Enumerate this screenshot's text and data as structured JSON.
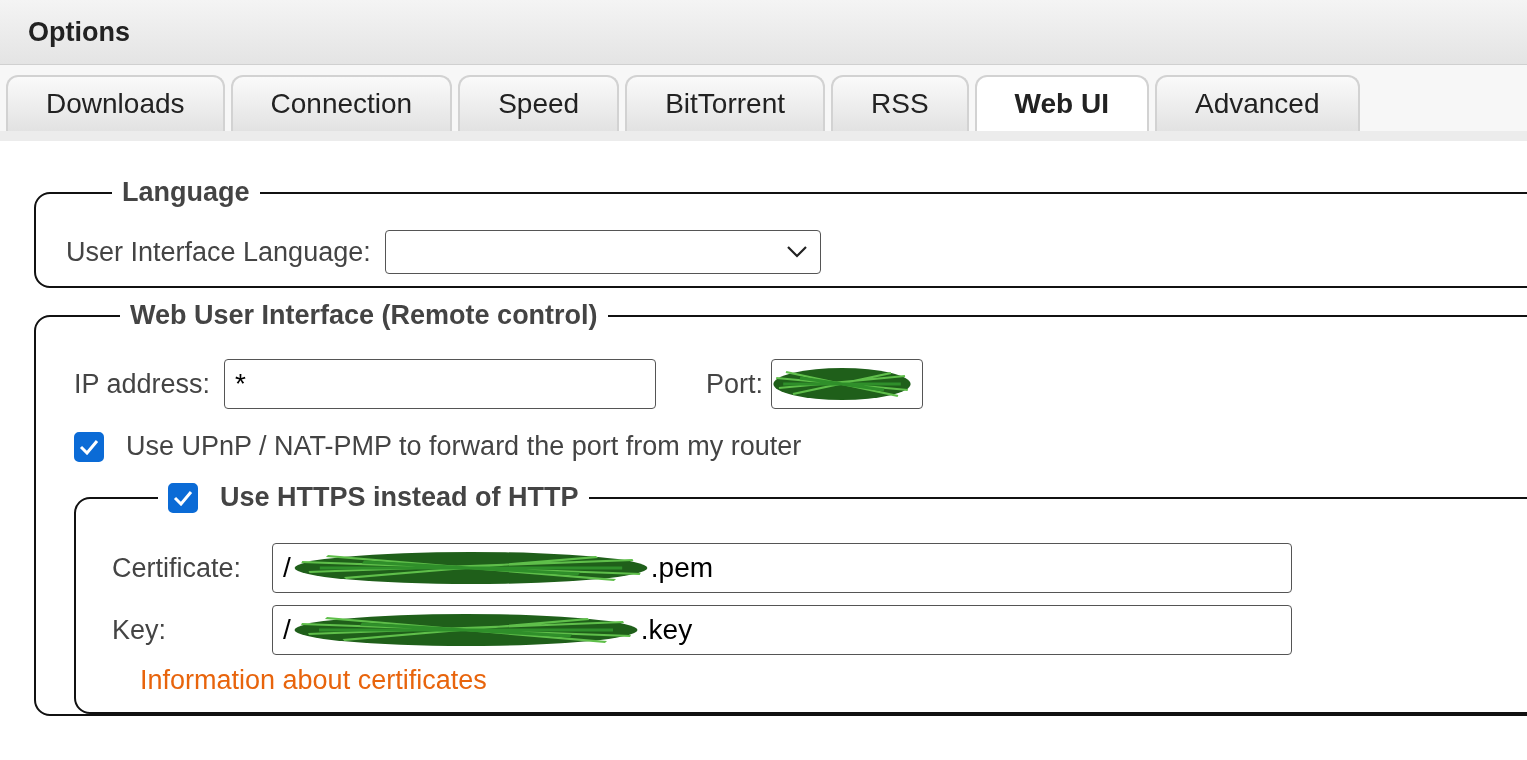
{
  "window": {
    "title": "Options"
  },
  "tabs": [
    {
      "label": "Downloads",
      "selected": false
    },
    {
      "label": "Connection",
      "selected": false
    },
    {
      "label": "Speed",
      "selected": false
    },
    {
      "label": "BitTorrent",
      "selected": false
    },
    {
      "label": "RSS",
      "selected": false
    },
    {
      "label": "Web UI",
      "selected": true
    },
    {
      "label": "Advanced",
      "selected": false
    }
  ],
  "language": {
    "legend": "Language",
    "label": "User Interface Language:"
  },
  "web_ui": {
    "legend": "Web User Interface (Remote control)",
    "ip_label": "IP address:",
    "ip_value": "*",
    "port_label": "Port:",
    "upnp": {
      "label": "Use UPnP / NAT-PMP to forward the port from my router",
      "checked": true
    },
    "https": {
      "label": "Use HTTPS instead of HTTP",
      "checked": true,
      "certificate_label": "Certificate:",
      "certificate_start": "/",
      "certificate_end": ".pem",
      "key_label": "Key:",
      "key_start": "/",
      "key_end": ".key",
      "info_link": "Information about certificates"
    }
  }
}
